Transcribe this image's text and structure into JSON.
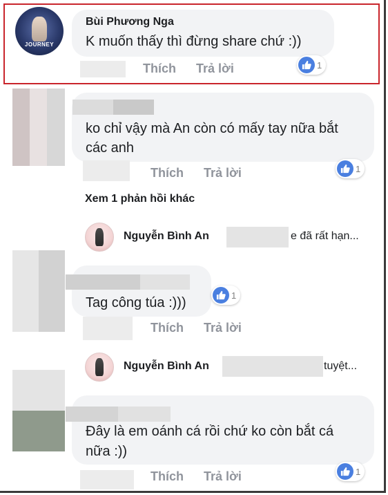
{
  "comments": [
    {
      "author": "Bùi Phương Nga",
      "text": "K muốn thấy thì đừng share chứ :))",
      "avatar_badge": "JOURNEY",
      "like_label": "Thích",
      "reply_label": "Trả lời",
      "reaction_count": "1"
    },
    {
      "text_line1": "ko chỉ vậy mà An còn có mấy tay nữa bắt",
      "text_line2": "các anh",
      "like_label": "Thích",
      "reply_label": "Trả lời",
      "reaction_count": "1",
      "more_replies": "Xem 1 phản hồi khác",
      "reply_author": "Nguyễn Bình An",
      "reply_snippet": "e đã rất hạn..."
    },
    {
      "text": "Tag công túa :)))",
      "like_label": "Thích",
      "reply_label": "Trả lời",
      "reaction_count": "1",
      "reply_author": "Nguyễn Bình An",
      "reply_snippet": "tuyệt..."
    },
    {
      "text_line1": "Đây là em oánh cá rồi chứ ko còn bắt cá",
      "text_line2": "nữa :))",
      "like_label": "Thích",
      "reply_label": "Trả lời",
      "reaction_count": "1"
    }
  ],
  "colors": {
    "highlight_border": "#c9242b",
    "bubble_bg": "#f2f3f5",
    "like_blue": "#4a7fe0",
    "action_gray": "#90949c"
  },
  "icons": {
    "reaction": "thumbs-up-icon"
  }
}
